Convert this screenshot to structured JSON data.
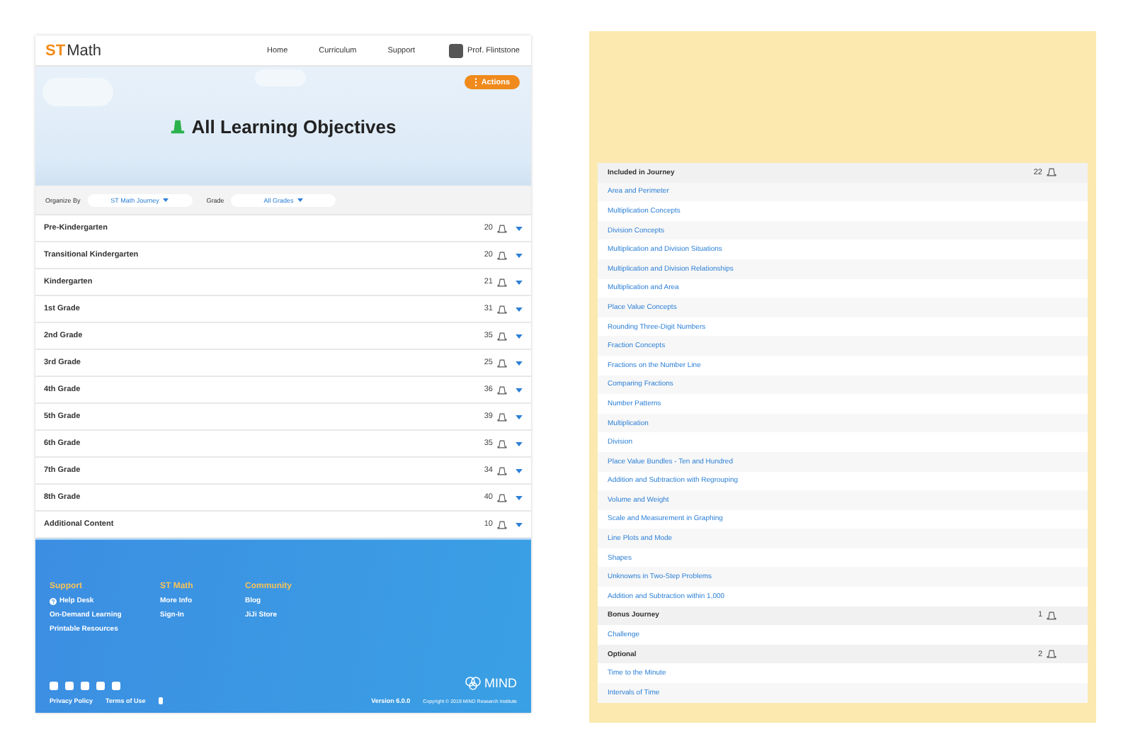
{
  "header": {
    "logo_accent": "ST",
    "logo_text": "Math",
    "nav": [
      {
        "label": "Home"
      },
      {
        "label": "Curriculum"
      },
      {
        "label": "Support"
      }
    ],
    "user": "Prof. Flintstone"
  },
  "hero": {
    "actions_button": "Actions",
    "title": "All Learning Objectives"
  },
  "filters": [
    {
      "label": "Organize By",
      "value": "ST Math Journey"
    },
    {
      "label": "Grade",
      "value": "All Grades"
    }
  ],
  "grades": [
    {
      "name": "Pre-Kindergarten",
      "count": "20"
    },
    {
      "name": "Transitional Kindergarten",
      "count": "20"
    },
    {
      "name": "Kindergarten",
      "count": "21"
    },
    {
      "name": "1st Grade",
      "count": "31"
    },
    {
      "name": "2nd Grade",
      "count": "35"
    },
    {
      "name": "3rd Grade",
      "count": "25"
    },
    {
      "name": "4th Grade",
      "count": "36"
    },
    {
      "name": "5th Grade",
      "count": "39"
    },
    {
      "name": "6th Grade",
      "count": "35"
    },
    {
      "name": "7th Grade",
      "count": "34"
    },
    {
      "name": "8th Grade",
      "count": "40"
    },
    {
      "name": "Additional Content",
      "count": "10"
    }
  ],
  "footer": {
    "columns": [
      {
        "heading": "Support",
        "links": [
          {
            "label": "Help Desk",
            "icon": true
          },
          {
            "label": "On-Demand Learning",
            "icon": false
          },
          {
            "label": "Printable Resources",
            "icon": false
          }
        ]
      },
      {
        "heading": "ST Math",
        "links": [
          {
            "label": "More Info",
            "icon": false
          },
          {
            "label": "Sign-In",
            "icon": false
          }
        ]
      },
      {
        "heading": "Community",
        "links": [
          {
            "label": "Blog",
            "icon": false
          },
          {
            "label": "JiJi Store",
            "icon": false
          }
        ]
      }
    ],
    "legal_links": [
      "Privacy Policy",
      "Terms of Use"
    ],
    "version": "Version 6.0.0",
    "brand": "MIND",
    "copyright": "Copyright © 2019 MIND Research Institute"
  },
  "objective_groups": [
    {
      "title": "Included in Journey",
      "count": "22",
      "items": [
        "Area and Perimeter",
        "Multiplication Concepts",
        "Division Concepts",
        "Multiplication and Division Situations",
        "Multiplication and Division Relationships",
        "Multiplication and Area",
        "Place Value Concepts",
        "Rounding Three-Digit Numbers",
        "Fraction Concepts",
        "Fractions on the Number Line",
        "Comparing Fractions",
        "Number Patterns",
        "Multiplication",
        "Division",
        "Place Value Bundles - Ten and Hundred",
        "Addition and Subtraction with Regrouping",
        "Volume and Weight",
        "Scale and Measurement in Graphing",
        "Line Plots and Mode",
        "Shapes",
        "Unknowns in Two-Step Problems",
        "Addition and Subtraction within 1,000"
      ]
    },
    {
      "title": "Bonus Journey",
      "count": "1",
      "items": [
        "Challenge"
      ]
    },
    {
      "title": "Optional",
      "count": "2",
      "items": [
        "Time to the Minute",
        "Intervals of Time"
      ]
    }
  ]
}
